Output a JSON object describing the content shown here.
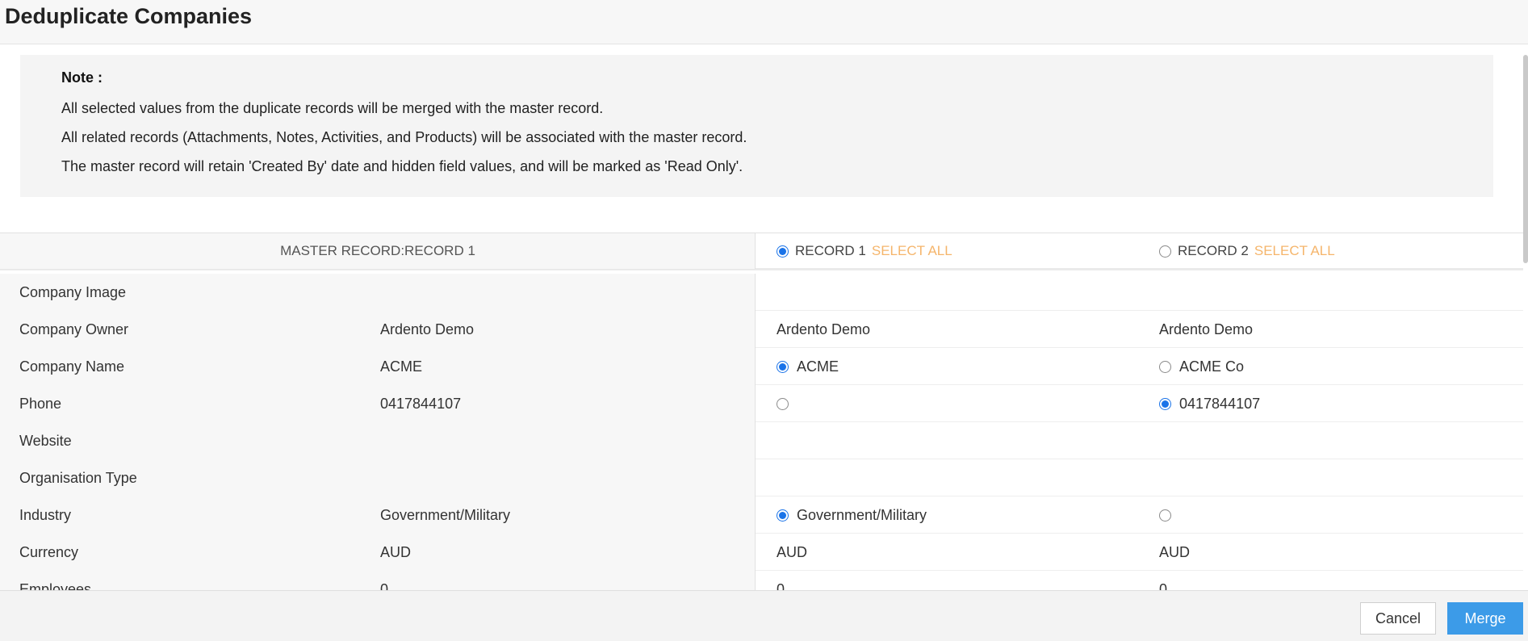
{
  "header": {
    "title": "Deduplicate Companies"
  },
  "note": {
    "title": "Note :",
    "lines": [
      "All selected values from the duplicate records will be merged with the master record.",
      "All related records (Attachments, Notes, Activities, and Products) will be associated with the master record.",
      "The master record will retain 'Created By' date and hidden field values, and will be marked as 'Read Only'."
    ]
  },
  "table_header": {
    "master_label": "MASTER RECORD:RECORD 1",
    "record1_label": "RECORD 1",
    "record2_label": "RECORD 2",
    "select_all": "SELECT ALL",
    "record1_selected": true,
    "record2_selected": false
  },
  "rows": [
    {
      "label": "Company Image",
      "master": "",
      "rec1": "",
      "rec2": ""
    },
    {
      "label": "Company Owner",
      "master": "Ardento Demo",
      "rec1": "Ardento Demo",
      "rec2": "Ardento Demo"
    },
    {
      "label": "Company Name",
      "master": "ACME",
      "rec1": "ACME",
      "rec2": "ACME Co",
      "rec1_selected": true,
      "rec2_selected": false
    },
    {
      "label": "Phone",
      "master": "0417844107",
      "rec1": "",
      "rec2": "0417844107",
      "rec1_selected": false,
      "rec2_selected": true
    },
    {
      "label": "Website",
      "master": "",
      "rec1": "",
      "rec2": ""
    },
    {
      "label": "Organisation Type",
      "master": "",
      "rec1": "",
      "rec2": ""
    },
    {
      "label": "Industry",
      "master": "Government/Military",
      "rec1": "Government/Military",
      "rec2": "",
      "rec1_selected": true,
      "rec2_selected": false
    },
    {
      "label": "Currency",
      "master": "AUD",
      "rec1": "AUD",
      "rec2": "AUD"
    },
    {
      "label": "Employees",
      "master": "0",
      "rec1": "0",
      "rec2": "0"
    }
  ],
  "footer": {
    "cancel_label": "Cancel",
    "merge_label": "Merge"
  },
  "colors": {
    "accent": "#1a73e8",
    "select_all": "#f5b56b",
    "merge_button": "#3c9be8"
  }
}
